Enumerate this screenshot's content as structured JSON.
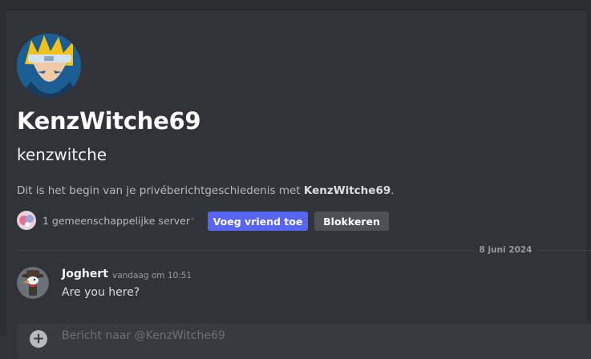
{
  "profile": {
    "display_name": "KenzWitche69",
    "username": "kenzwitche",
    "intro_prefix": "Dit is het begin van je privéberichtgeschiedenis met ",
    "intro_name": "KenzWitche69",
    "intro_suffix": ".",
    "mutual_servers": "1 gemeenschappelijke server",
    "add_friend_label": "Voeg vriend toe",
    "block_label": "Blokkeren"
  },
  "divider": {
    "date": "8 juni 2024"
  },
  "messages": [
    {
      "author": "Joghert",
      "timestamp": "vandaag om 10:51",
      "text": "Are you here?"
    }
  ],
  "composer": {
    "placeholder": "Bericht naar @KenzWitche69"
  },
  "colors": {
    "background": "#313338",
    "accent": "#5865f2",
    "secondary_button": "#4e5058"
  },
  "icons": {
    "profile_avatar": "anime-avatar-icon",
    "server": "server-icon",
    "message_avatar": "duck-avatar-icon",
    "composer_add": "plus-circle-icon"
  }
}
